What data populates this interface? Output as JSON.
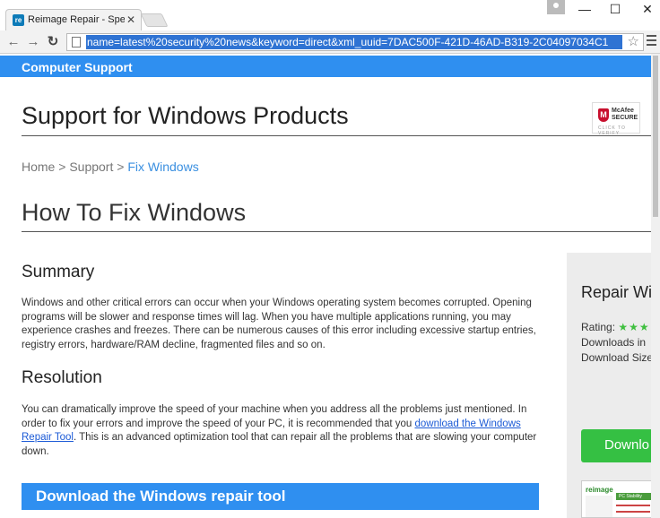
{
  "browser": {
    "tab_title": "Reimage Repair - Speed u",
    "tab_favicon": "re",
    "tab_close": "✕",
    "url": "name=latest%20security%20news&keyword=direct&xml_uuid=7DAC500F-421D-46AD-B319-2C04097034C1",
    "window_controls": {
      "minimize": "—",
      "maximize": "☐",
      "close": "✕"
    },
    "icons": [
      "back-icon",
      "forward-icon",
      "reload-icon",
      "page-icon",
      "star-icon",
      "menu-icon",
      "profile-icon"
    ]
  },
  "header": {
    "bar_title": "Computer Support"
  },
  "page": {
    "title": "Support for Windows Products",
    "breadcrumb": {
      "home": "Home",
      "sep1": " > ",
      "support": "Support",
      "sep2": " > ",
      "current": "Fix Windows"
    },
    "section_title": "How To Fix Windows"
  },
  "badge": {
    "brand_line1": "McAfee",
    "brand_line2": "SECURE",
    "tagline": "CLICK TO VERIFY"
  },
  "summary": {
    "heading": "Summary",
    "text": "Windows and other critical errors can occur when your Windows operating system becomes corrupted. Opening programs will be slower and response times will lag. When you have multiple applications running, you may experience crashes and freezes. There can be numerous causes of this error including excessive startup entries, registry errors, hardware/RAM decline, fragmented files and so on."
  },
  "resolution": {
    "heading": "Resolution",
    "text_before": "You can dramatically improve the speed of your machine when you address all the problems just mentioned. In order to fix your errors and improve the speed of your PC, it is recommended that you ",
    "link": "download the Windows Repair Tool",
    "text_after": ". This is an advanced optimization tool that can repair all the problems that are slowing your computer down."
  },
  "download_banner": "Download the Windows repair tool",
  "sidebar": {
    "title": "Repair Wi",
    "rating_label": "Rating: ",
    "rating_stars": "★★★",
    "downloads_line": "Downloads in",
    "size_line": "Download Size",
    "button_label": "Downlo",
    "screenshot_logo": "reimage",
    "screenshot_heading": "PC Stability"
  },
  "colors": {
    "accent": "#2f8ff0",
    "button_green": "#35c043",
    "link": "#1b5ad6"
  }
}
